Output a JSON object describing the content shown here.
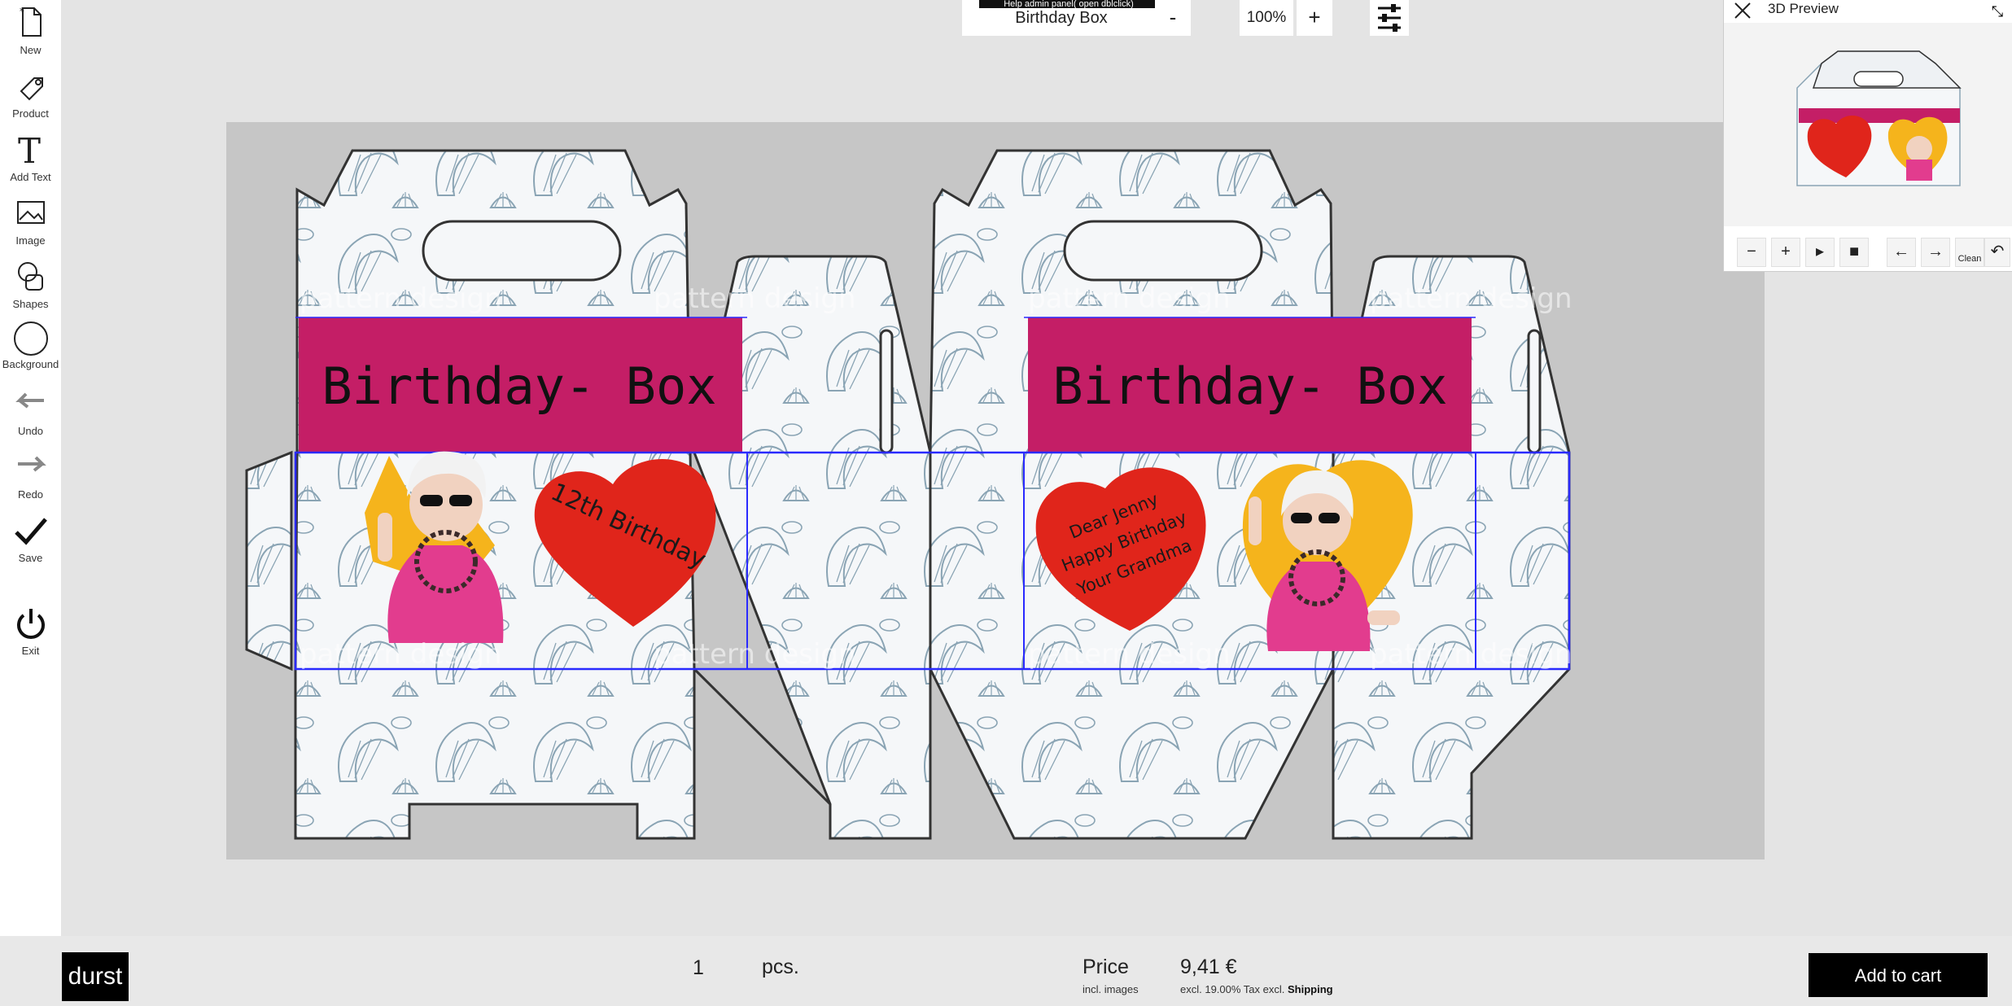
{
  "toolbar": {
    "items": [
      {
        "label": "New",
        "icon": "new-document-icon"
      },
      {
        "label": "Product",
        "icon": "tag-icon"
      },
      {
        "label": "Add Text",
        "icon": "text-icon"
      },
      {
        "label": "Image",
        "icon": "image-icon"
      },
      {
        "label": "Shapes",
        "icon": "shapes-icon"
      },
      {
        "label": "Background",
        "icon": "circle-icon"
      },
      {
        "label": "Undo",
        "icon": "undo-icon"
      },
      {
        "label": "Redo",
        "icon": "redo-icon"
      },
      {
        "label": "Save",
        "icon": "check-icon"
      },
      {
        "label": "Exit",
        "icon": "power-icon"
      }
    ]
  },
  "header": {
    "title_value": "Birthday Box",
    "help_tip": "Help admin panel( open dblclick)",
    "zoom_out": "-",
    "zoom_level": "100%",
    "zoom_in": "+"
  },
  "canvas": {
    "front_banner": "Birthday- Box",
    "back_banner": "Birthday- Box",
    "front_heart_text": "12th Birthday",
    "back_heart_lines": [
      "Dear Jenny",
      "Happy Birthday",
      "Your Grandma"
    ],
    "watermark": "pattern design",
    "colors": {
      "banner": "#c41e66",
      "heart": "#e0251b",
      "sun": "#f5b41c",
      "dieline_bg": "#c6c6c6",
      "panel": "#f5f7f9",
      "pattern": "#8aa4b4",
      "guide": "#2a2aff"
    }
  },
  "preview": {
    "title": "3D Preview",
    "close_icon": "close-icon",
    "controls": [
      {
        "label": "−",
        "name": "zoom-out"
      },
      {
        "label": "+",
        "name": "zoom-in"
      },
      {
        "label": "▸",
        "name": "play"
      },
      {
        "label": "■",
        "name": "stop"
      },
      {
        "label": "←",
        "name": "rotate-left"
      },
      {
        "label": "→",
        "name": "rotate-right"
      },
      {
        "label": "Clean",
        "name": "clean"
      },
      {
        "label": "↶",
        "name": "reset"
      }
    ]
  },
  "footer": {
    "logo": "durst",
    "quantity": "1",
    "unit": "pcs.",
    "price_label": "Price",
    "price_sub": "incl. images",
    "price_value": "9,41 €",
    "price_note_prefix": "excl. 19.00% Tax excl.",
    "price_note_link": "Shipping",
    "cart_label": "Add to cart"
  }
}
